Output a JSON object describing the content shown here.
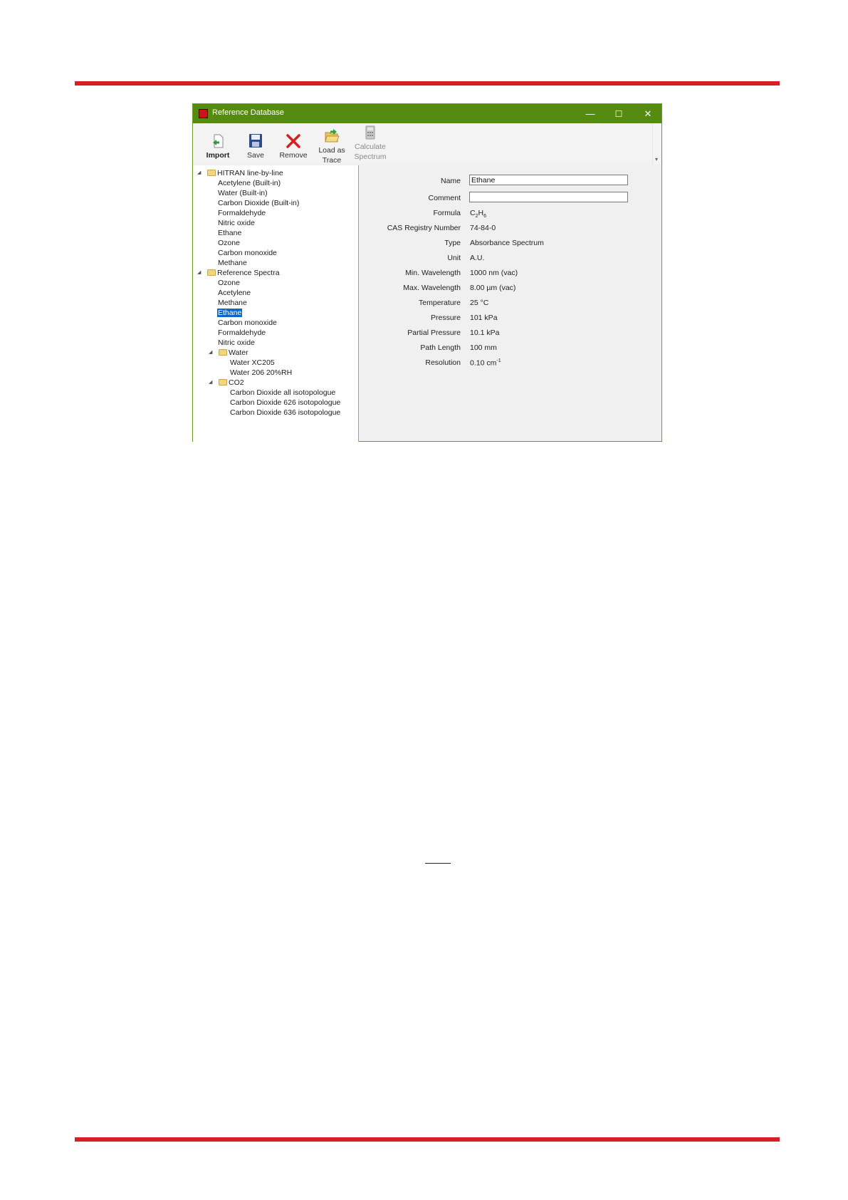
{
  "window": {
    "title": "Reference Database",
    "minimize_glyph": "—",
    "maximize_glyph": "☐",
    "close_glyph": "✕"
  },
  "toolbar": {
    "import_label": "Import",
    "save_label": "Save",
    "remove_label": "Remove",
    "load_label_line1": "Load as",
    "load_label_line2": "Trace",
    "calculate_label_line1": "Calculate",
    "calculate_label_line2": "Spectrum",
    "overflow_glyph": "▾"
  },
  "tree": {
    "hitran": {
      "label": "HITRAN line-by-line",
      "items": [
        "Acetylene (Built-in)",
        "Water (Built-in)",
        "Carbon Dioxide (Built-in)",
        "Formaldehyde",
        "Nitric oxide",
        "Ethane",
        "Ozone",
        "Carbon monoxide",
        "Methane"
      ]
    },
    "reference": {
      "label": "Reference Spectra",
      "items": [
        "Ozone",
        "Acetylene",
        "Methane",
        "Ethane",
        "Carbon monoxide",
        "Formaldehyde",
        "Nitric oxide"
      ],
      "selected": "Ethane",
      "water": {
        "label": "Water",
        "items": [
          "Water XC205",
          "Water 206 20%RH"
        ]
      },
      "co2": {
        "label": "CO2",
        "items": [
          "Carbon Dioxide all isotopologue",
          "Carbon Dioxide 626 isotopologue",
          "Carbon Dioxide 636 isotopologue"
        ]
      }
    }
  },
  "details": {
    "name_label": "Name",
    "name_value": "Ethane",
    "comment_label": "Comment",
    "comment_value": "",
    "formula_label": "Formula",
    "formula_c": "C",
    "formula_c_sub": "2",
    "formula_h": "H",
    "formula_h_sub": "6",
    "cas_label": "CAS Registry Number",
    "cas_value": "74-84-0",
    "type_label": "Type",
    "type_value": "Absorbance Spectrum",
    "unit_label": "Unit",
    "unit_value": "A.U.",
    "min_wl_label": "Min. Wavelength",
    "min_wl_value": "1000 nm (vac)",
    "max_wl_label": "Max. Wavelength",
    "max_wl_value": "8.00 µm (vac)",
    "temperature_label": "Temperature",
    "temperature_value": "25 °C",
    "pressure_label": "Pressure",
    "pressure_value": "101 kPa",
    "partial_pressure_label": "Partial Pressure",
    "partial_pressure_value": "10.1 kPa",
    "path_length_label": "Path Length",
    "path_length_value": "100 mm",
    "resolution_label": "Resolution",
    "resolution_value": "0.10 cm",
    "resolution_exp": "-1"
  }
}
